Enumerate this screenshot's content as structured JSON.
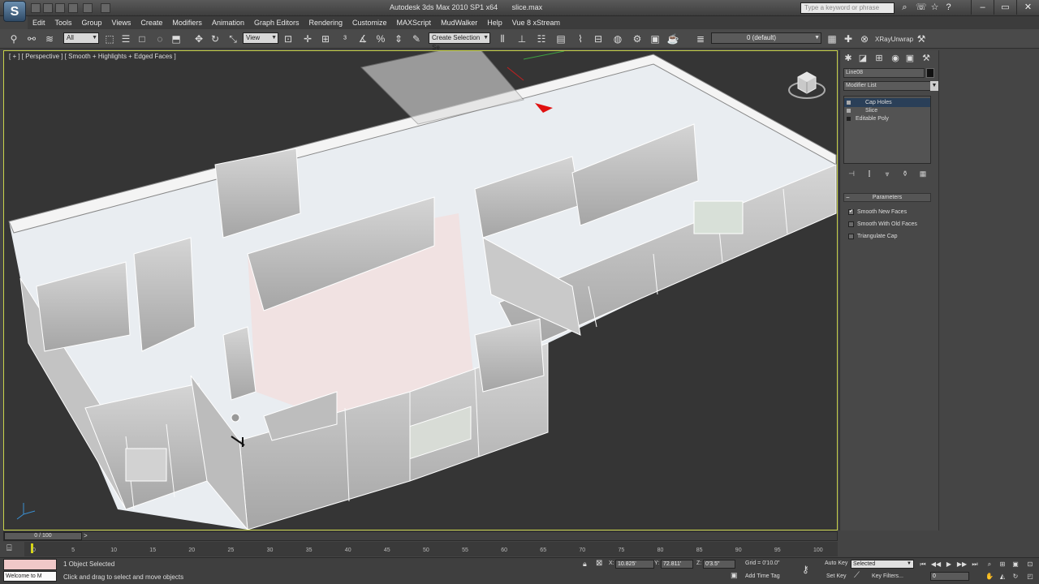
{
  "titlebar": {
    "logo_text": "S",
    "title_app": "Autodesk 3ds Max  2010 SP1 x64",
    "title_file": "slice.max",
    "search_placeholder": "Type a keyword or phrase",
    "minimize": "–",
    "maximize": "▭",
    "close": "✕"
  },
  "menu": [
    "Edit",
    "Tools",
    "Group",
    "Views",
    "Create",
    "Modifiers",
    "Animation",
    "Graph Editors",
    "Rendering",
    "Customize",
    "MAXScript",
    "MudWalker",
    "Help",
    "Vue 8 xStream"
  ],
  "toolbar": {
    "selection_filter": "All",
    "ref_coord": "View",
    "named_selection": "Create Selection Se",
    "layer": "0 (default)",
    "xray_label": "XRayUnwrap"
  },
  "viewport": {
    "label": "[ + ] [ Perspective ] [ Smooth + Highlights + Edged Faces ]"
  },
  "command_panel": {
    "object_name": "Line08",
    "modifier_list": "Modifier List",
    "stack": [
      "Cap Holes",
      "Slice",
      "Editable Poly"
    ],
    "rollout_title": "Parameters",
    "params": [
      {
        "label": "Smooth New Faces",
        "checked": true
      },
      {
        "label": "Smooth With Old Faces",
        "checked": false
      },
      {
        "label": "Triangulate Cap",
        "checked": false
      }
    ]
  },
  "timeline": {
    "slider_text": "0 / 100",
    "ticks": [
      "0",
      "5",
      "10",
      "15",
      "20",
      "25",
      "30",
      "35",
      "40",
      "45",
      "50",
      "55",
      "60",
      "65",
      "70",
      "75",
      "80",
      "85",
      "90",
      "95",
      "100"
    ]
  },
  "status": {
    "mini_listener": "Welcome to M",
    "selected": "1 Object Selected",
    "prompt": "Click and drag to select and move objects",
    "x_label": "X:",
    "x_value": "10.825'",
    "y_label": "Y:",
    "y_value": "72.811'",
    "z_label": "Z:",
    "z_value": "0'3.5\"",
    "grid": "Grid = 0'10.0\"",
    "add_time_tag": "Add Time Tag",
    "auto_key": "Auto Key",
    "auto_key_mode": "Selected",
    "set_key": "Set Key",
    "key_filters": "Key Filters...",
    "frame": "0"
  },
  "colors": {
    "viewport_border": "#c8d24a",
    "selected_stack": "#2a3f58",
    "gizmo_red": "#e01010"
  }
}
